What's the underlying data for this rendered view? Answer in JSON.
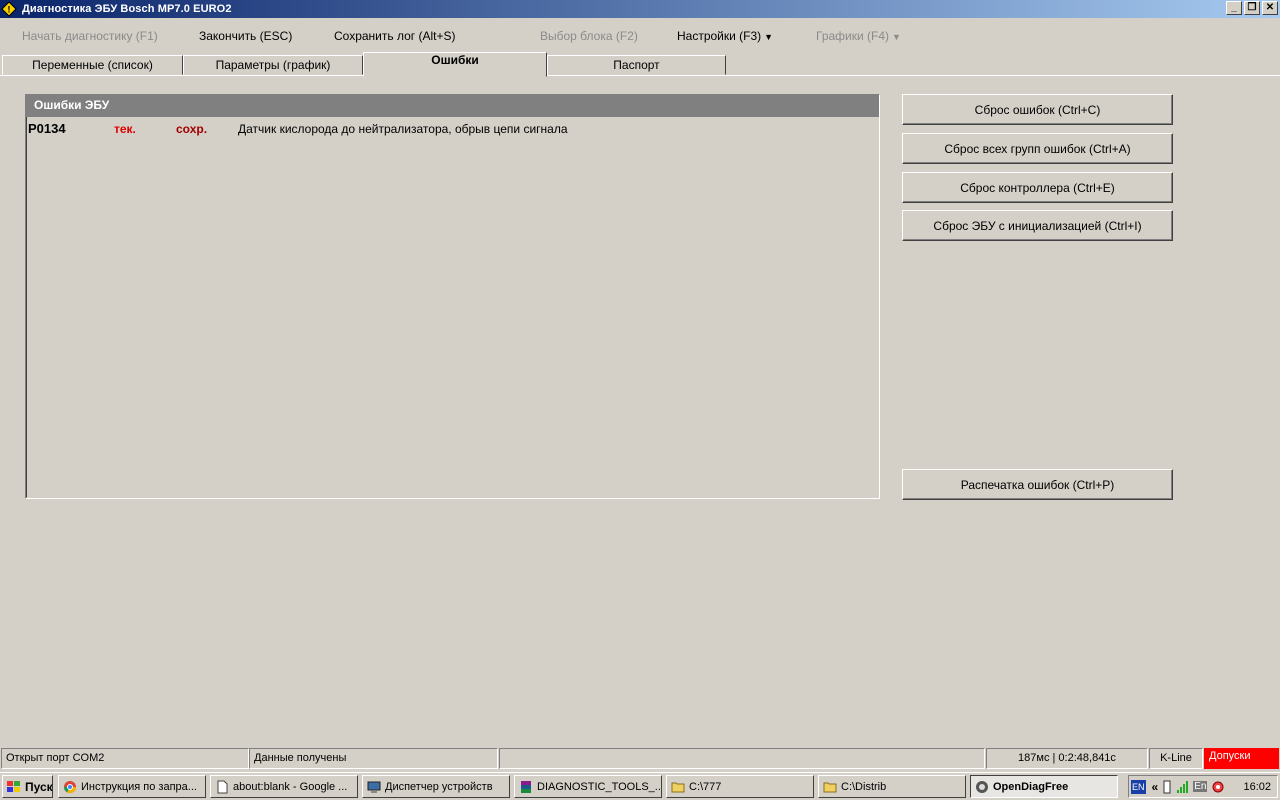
{
  "window": {
    "title": "Диагностика ЭБУ Bosch MP7.0 EURO2",
    "controls": [
      "_",
      "❐",
      "✕"
    ]
  },
  "menu": {
    "start_diag": "Начать диагностику (F1)",
    "finish": "Закончить (ESC)",
    "save_log": "Сохранить лог (Alt+S)",
    "select_block": "Выбор блока (F2)",
    "settings": "Настройки (F3)",
    "graphs": "Графики (F4)"
  },
  "tabs": [
    {
      "label": "Переменные (список)"
    },
    {
      "label": "Параметры (график)"
    },
    {
      "label": "Ошибки"
    },
    {
      "label": "Паспорт"
    }
  ],
  "errors_panel": {
    "title": "Ошибки ЭБУ",
    "rows": [
      {
        "code": "P0134",
        "current": "тек.",
        "saved": "сохр.",
        "description": "Датчик кислорода до нейтрализатора, обрыв цепи сигнала"
      }
    ]
  },
  "buttons": {
    "reset_errors": "Сброс ошибок (Ctrl+C)",
    "reset_all_groups": "Сброс всех групп ошибок (Ctrl+A)",
    "reset_controller": "Сброс контроллера (Ctrl+E)",
    "reset_ecu_init": "Сброс ЭБУ с инициализацией (Ctrl+I)",
    "print_errors": "Распечатка ошибок (Ctrl+P)"
  },
  "status": {
    "port": "Открыт порт COM2",
    "data": "Данные получены",
    "empty": "",
    "timing": "187мс | 0:2:48,841с",
    "protocol": "K-Line",
    "tolerances": "Допуски"
  },
  "taskbar": {
    "start": "Пуск",
    "tasks": [
      {
        "label": "Инструкция по запра..."
      },
      {
        "label": "about:blank - Google ..."
      },
      {
        "label": "Диспетчер устройств"
      },
      {
        "label": "DIAGNOSTIC_TOOLS_..."
      },
      {
        "label": "C:\\777"
      },
      {
        "label": "C:\\Distrib"
      },
      {
        "label": "OpenDiagFree"
      }
    ],
    "tray_lang": "EN",
    "tray_lang2": "En",
    "tray_chevron": "«",
    "clock": "16:02"
  },
  "colors": {
    "title_gradient_start": "#0a246a",
    "title_gradient_end": "#a6caf0",
    "error_current": "#e00000",
    "error_saved": "#a00000",
    "panel_header": "#808080",
    "tolerances_bg": "#ff0000"
  }
}
